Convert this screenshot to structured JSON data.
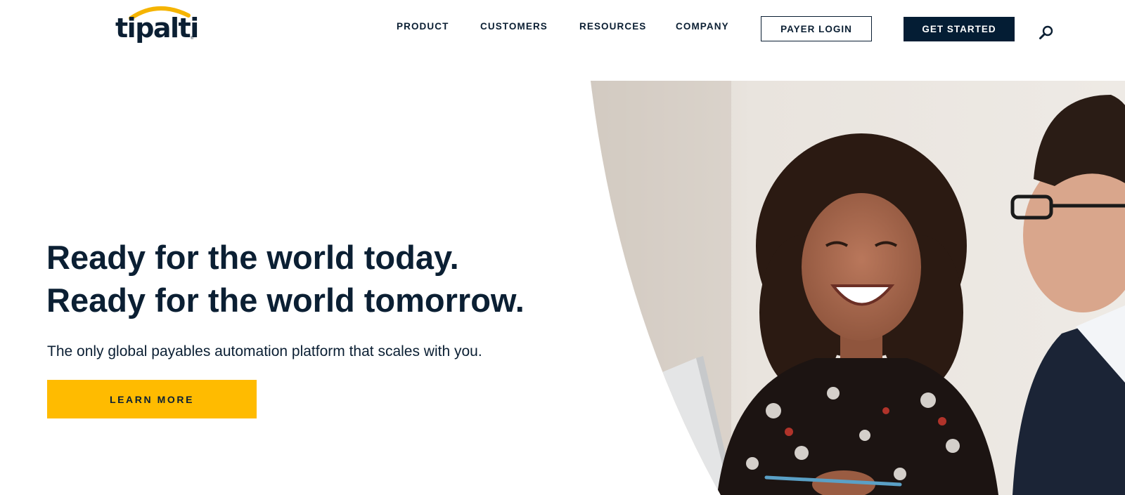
{
  "header": {
    "logo_text": "tipalti",
    "logo_mark": "®",
    "nav": [
      "PRODUCT",
      "CUSTOMERS",
      "RESOURCES",
      "COMPANY"
    ],
    "payer_login": "PAYER LOGIN",
    "get_started": "GET STARTED",
    "search_icon": "search-icon"
  },
  "hero": {
    "headline_line1": "Ready for the world today.",
    "headline_line2": "Ready for the world tomorrow.",
    "subheadline": "The only global payables automation platform that scales with you.",
    "cta_label": "LEARN MORE",
    "image_subject": "smiling woman and man in glasses at a table"
  },
  "colors": {
    "navy": "#0b1f33",
    "button_dark": "#041d34",
    "accent_yellow": "#ffbb00",
    "background": "#ffffff"
  }
}
